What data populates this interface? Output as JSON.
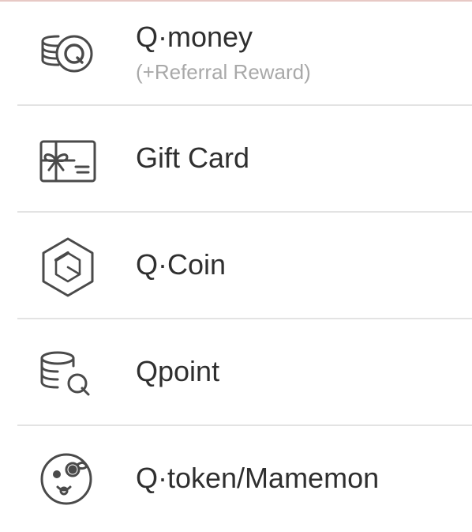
{
  "menu": {
    "items": [
      {
        "icon": "qmoney-coins-icon",
        "label": "Q·money",
        "sublabel": "(+Referral Reward)"
      },
      {
        "icon": "gift-card-icon",
        "label": "Gift Card"
      },
      {
        "icon": "qcoin-hexagon-icon",
        "label": "Q·Coin"
      },
      {
        "icon": "qpoint-coins-icon",
        "label": "Qpoint"
      },
      {
        "icon": "qtoken-mamemon-icon",
        "label": "Q·token/Mamemon"
      }
    ]
  },
  "colors": {
    "text": "#2f2f2f",
    "subtext": "#a9a9a9",
    "divider": "#e3e3e3",
    "icon_stroke": "#4a4a4a",
    "top_accent": "#e7c9c5"
  }
}
